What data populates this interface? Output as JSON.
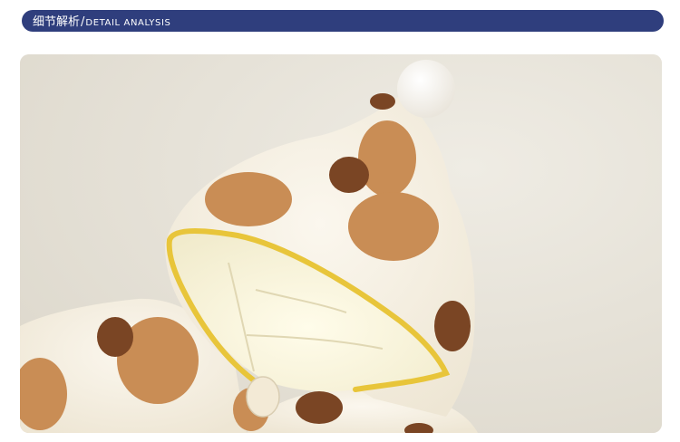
{
  "header": {
    "title_cn": "细节解析",
    "separator": "/",
    "title_en": "DETAIL ANALYSIS",
    "bar_color": "#2f3e7d"
  },
  "photo": {
    "subject": "baby-hood-detail-photo",
    "background_color": "#eae6dc",
    "fleece_color": "#f5efe2",
    "spot_light_color": "#c98d55",
    "spot_dark_color": "#7a4524",
    "trim_color": "#e8c53a"
  }
}
